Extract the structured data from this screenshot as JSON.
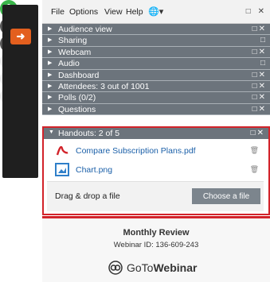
{
  "menu": {
    "items": [
      "File",
      "Options",
      "View",
      "Help"
    ],
    "globe_icon": "globe-icon",
    "window_controls": "□ ✕"
  },
  "panes": [
    {
      "label": "Audience view",
      "controls": "□✕"
    },
    {
      "label": "Sharing",
      "controls": "□"
    },
    {
      "label": "Webcam",
      "controls": "□✕"
    },
    {
      "label": "Audio",
      "controls": "□"
    },
    {
      "label": "Dashboard",
      "controls": "□✕"
    },
    {
      "label": "Attendees: 3 out of 1001",
      "controls": "□✕"
    },
    {
      "label": "Polls (0/2)",
      "controls": "□✕"
    },
    {
      "label": "Questions",
      "controls": "□✕"
    }
  ],
  "handouts": {
    "label": "Handouts: 2 of 5",
    "controls": "□✕",
    "files": [
      {
        "name": "Compare Subscription Plans.pdf",
        "icon": "pdf-icon"
      },
      {
        "name": "Chart.png",
        "icon": "image-icon"
      }
    ],
    "drag_text": "Drag & drop a file",
    "choose_label": "Choose a file"
  },
  "footer": {
    "title": "Monthly Review",
    "webinar_id": "Webinar ID: 136-609-243",
    "logo_regular": "GoTo",
    "logo_bold": "Webinar"
  },
  "colors": {
    "accent_orange": "#e35f1e",
    "mic_green": "#3ab54a",
    "highlight_red": "#d2232a",
    "pane_gray": "#6c747c"
  }
}
